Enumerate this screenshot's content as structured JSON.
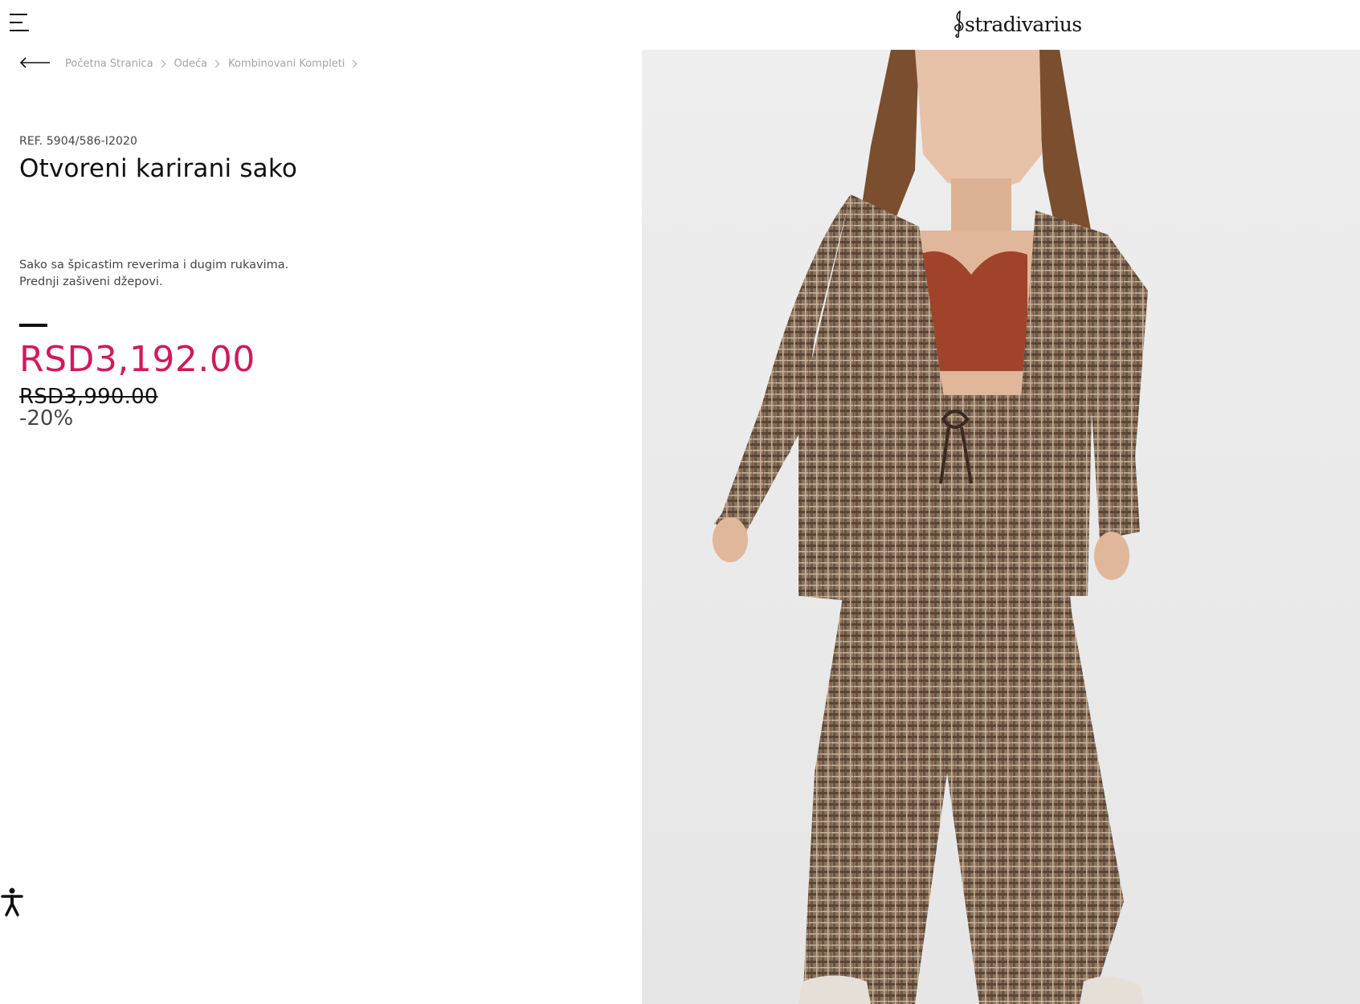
{
  "header": {
    "menu_icon": "hamburger-menu-icon",
    "brand": "stradivarius"
  },
  "breadcrumb": {
    "back_icon": "arrow-left-icon",
    "items": [
      {
        "label": "Početna Stranica"
      },
      {
        "label": "Odeća"
      },
      {
        "label": "Kombinovani Kompleti"
      }
    ]
  },
  "product": {
    "ref": "REF. 5904/586-I2020",
    "title": "Otvoreni karirani sako",
    "description_line1": "Sako sa špicastim reverima i dugim rukavima.",
    "description_line2": "Prednji zašiveni džepovi.",
    "price_current": "RSD3,192.00",
    "price_old": "RSD3,990.00",
    "discount": "-20%",
    "image_icon": "product-photo"
  },
  "colors": {
    "sale_price": "#d1195f",
    "text": "#111111",
    "breadcrumb": "#a3a3a3"
  },
  "accessibility": {
    "icon": "accessibility-icon"
  }
}
